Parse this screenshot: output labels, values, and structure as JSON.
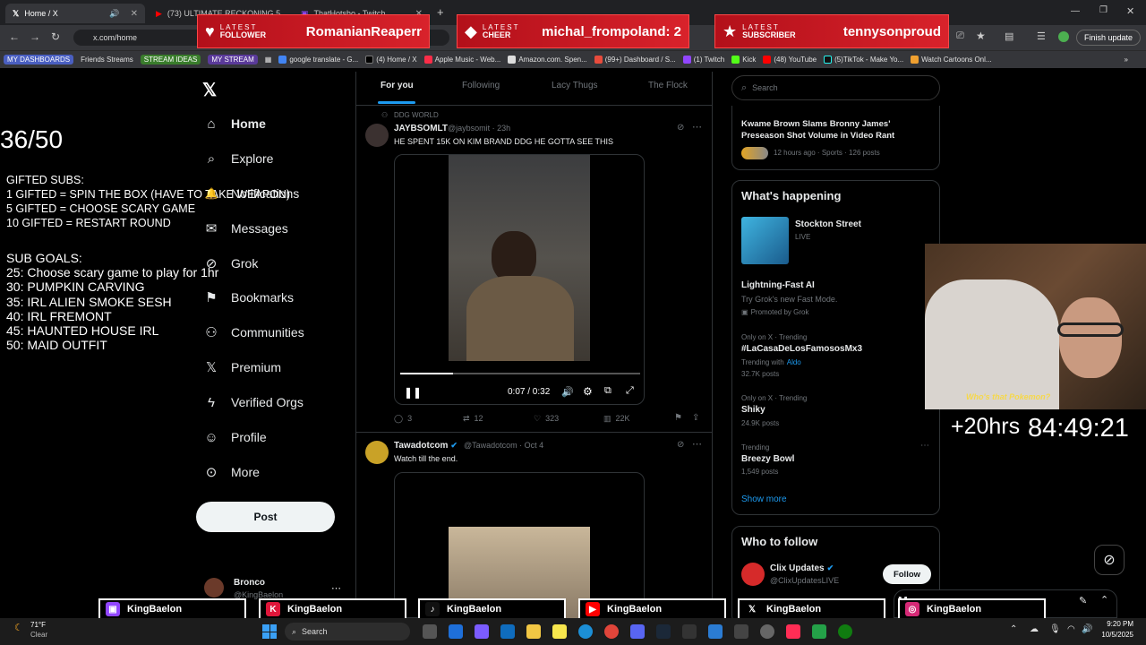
{
  "tabs": [
    {
      "title": "Home / X",
      "active": true
    },
    {
      "title": "(73) ULTIMATE RECKONING 5 MIC...",
      "active": false
    },
    {
      "title": "ThatHotsho - Twitch",
      "active": false
    }
  ],
  "address": {
    "url": "x.com/home",
    "update_label": "Finish update"
  },
  "bookmarks": [
    {
      "label": "MY DASHBOARDS",
      "color": "#4a5fc1"
    },
    {
      "label": "Friends Streams",
      "color": ""
    },
    {
      "label": "STREAM IDEAS",
      "color": "#3a7d2c"
    },
    {
      "label": "MY STREAM",
      "color": "#5a3a9a"
    },
    {
      "label": "google translate - G...",
      "color": ""
    },
    {
      "label": "(4) Home / X",
      "color": ""
    },
    {
      "label": "Apple Music - Web...",
      "color": ""
    },
    {
      "label": "Amazon.com. Spen...",
      "color": ""
    },
    {
      "label": "(99+) Dashboard / S...",
      "color": ""
    },
    {
      "label": "(1) Twitch",
      "color": ""
    },
    {
      "label": "Kick",
      "color": ""
    },
    {
      "label": "(48) YouTube",
      "color": ""
    },
    {
      "label": "(5)TikTok - Make Yo...",
      "color": ""
    },
    {
      "label": "Watch Cartoons Onl...",
      "color": ""
    }
  ],
  "alerts": {
    "follower": {
      "top": "LATEST",
      "label": "FOLLOWER",
      "value": "RomanianReaperr"
    },
    "cheer": {
      "top": "LATEST",
      "label": "CHEER",
      "value": "michal_frompoland: 2"
    },
    "subscriber": {
      "top": "LATEST",
      "label": "SUBSCRIBER",
      "value": "tennysonproud"
    }
  },
  "overlay": {
    "counter": "36/50",
    "gifted_title": "GIFTED SUBS:",
    "gifted": [
      "1 GIFTED = SPIN THE BOX (HAVE TO TAKE WEAPON)",
      "5 GIFTED = CHOOSE SCARY GAME",
      "10 GIFTED = RESTART ROUND"
    ],
    "goals_title": "SUB GOALS:",
    "goals": [
      "25: Choose scary game to play for 1hr",
      "30: PUMPKIN CARVING",
      "35: IRL ALIEN SMOKE SESH",
      "40: IRL FREMONT",
      "45: HAUNTED HOUSE IRL",
      "50: MAID OUTFIT"
    ],
    "timer_extra": "+20hrs",
    "timer": "84:49:21",
    "cam_caption": "Who's that Pokemon?"
  },
  "nav": {
    "items": [
      {
        "label": "Home",
        "icon": "home-icon",
        "glyph": "⌂"
      },
      {
        "label": "Explore",
        "icon": "search-icon",
        "glyph": "⌕"
      },
      {
        "label": "Notifications",
        "icon": "bell-icon",
        "glyph": "🔔"
      },
      {
        "label": "Messages",
        "icon": "mail-icon",
        "glyph": "✉"
      },
      {
        "label": "Grok",
        "icon": "grok-icon",
        "glyph": "⊘"
      },
      {
        "label": "Bookmarks",
        "icon": "bookmark-icon",
        "glyph": "🔖"
      },
      {
        "label": "Communities",
        "icon": "people-icon",
        "glyph": "👥"
      },
      {
        "label": "Premium",
        "icon": "x-logo-icon",
        "glyph": "𝕏"
      },
      {
        "label": "Verified Orgs",
        "icon": "lightning-icon",
        "glyph": "ϟ"
      },
      {
        "label": "Profile",
        "icon": "person-icon",
        "glyph": "👤"
      },
      {
        "label": "More",
        "icon": "more-circle-icon",
        "glyph": "⋯"
      }
    ],
    "post": "Post",
    "account_name": "Bronco",
    "account_handle": "@KingBaelon"
  },
  "timeline_tabs": [
    "For you",
    "Following",
    "Lacy Thugs",
    "The Flock"
  ],
  "tweet1": {
    "context": "DDG WORLD",
    "name": "JAYBSOMLT",
    "handle": "@jaybsomit · 23h",
    "text": "HE SPENT 15K ON KIM BRAND DDG HE GOTTA SEE THIS",
    "time": "0:07 / 0:32",
    "progress": 0.22,
    "replies": "3",
    "reposts": "12",
    "likes": "323",
    "views": "22K"
  },
  "tweet2": {
    "name": "Tawadotcom",
    "handle": "@Tawadotcom · Oct 4",
    "text": "Watch till the end."
  },
  "right": {
    "search_placeholder": "Search",
    "news_title": "Kwame Brown Slams Bronny James' Preseason Shot Volume in Video Rant",
    "news_meta": "12 hours ago · Sports · 126 posts",
    "happening": "What's happening",
    "live_title": "Stockton Street",
    "live_badge": "LIVE",
    "promo_title": "Lightning-Fast AI",
    "promo_text": "Try Grok's new Fast Mode.",
    "promo_meta": "Promoted by Grok",
    "trends": [
      {
        "cat": "Only on X · Trending",
        "title": "#LaCasaDeLosFamososMx3",
        "meta": "Trending with",
        "link": "Aldo",
        "posts": "32.7K posts"
      },
      {
        "cat": "Only on X · Trending",
        "title": "Shiky",
        "meta": "",
        "link": "",
        "posts": "24.9K posts"
      },
      {
        "cat": "Trending",
        "title": "Breezy Bowl",
        "meta": "",
        "link": "",
        "posts": "1,549 posts"
      }
    ],
    "show_more": "Show more",
    "who_to_follow": "Who to follow",
    "follow_name": "Clix Updates",
    "follow_handle": "@ClixUpdatesLIVE",
    "follow_btn": "Follow",
    "messages": "Messages"
  },
  "socials": [
    {
      "name": "KingBaelon",
      "icon": "twitch-icon",
      "color": "#9146ff",
      "glyph": "▣"
    },
    {
      "name": "KingBaelon",
      "icon": "kick-icon",
      "color": "#53fc18",
      "glyph": "K"
    },
    {
      "name": "KingBaelon",
      "icon": "tiktok-icon",
      "color": "#111",
      "glyph": "♪"
    },
    {
      "name": "KingBaelon",
      "icon": "youtube-icon",
      "color": "#ff0000",
      "glyph": "▶"
    },
    {
      "name": "KingBaelon",
      "icon": "x-icon",
      "color": "#000",
      "glyph": "𝕏"
    },
    {
      "name": "KingBaelon",
      "icon": "instagram-icon",
      "color": "#d62976",
      "glyph": "◎"
    }
  ],
  "taskbar": {
    "weather_temp": "71°F",
    "weather_desc": "Clear",
    "search": "Search",
    "time": "9:20 PM",
    "date": "10/5/2025"
  }
}
